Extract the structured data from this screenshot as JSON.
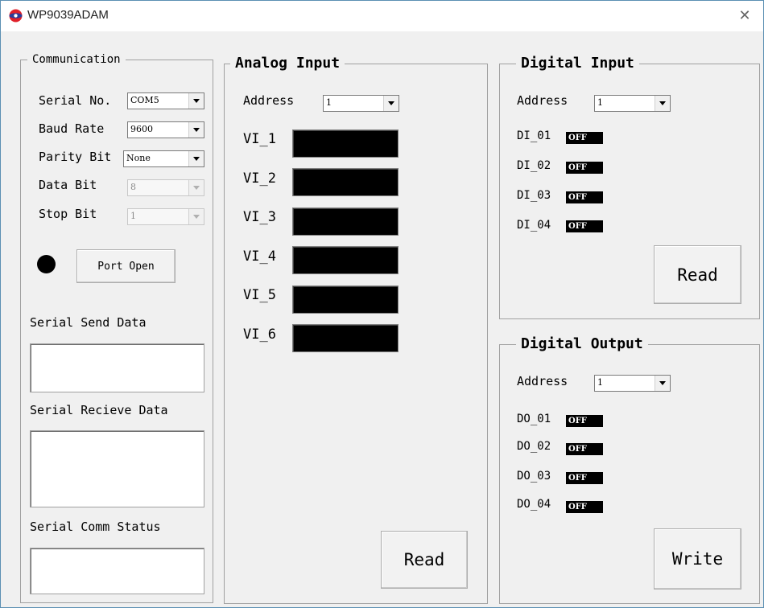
{
  "window": {
    "title": "WP9039ADAM"
  },
  "communication": {
    "legend": "Communication",
    "serial_no": {
      "label": "Serial No.",
      "value": "COM5"
    },
    "baud_rate": {
      "label": "Baud Rate",
      "value": "9600"
    },
    "parity_bit": {
      "label": "Parity Bit",
      "value": "None"
    },
    "data_bit": {
      "label": "Data Bit",
      "value": "8"
    },
    "stop_bit": {
      "label": "Stop Bit",
      "value": "1"
    },
    "port_open_label": "Port Open",
    "send_data_label": "Serial Send Data",
    "send_data_value": "",
    "receive_data_label": "Serial Recieve Data",
    "receive_data_value": "",
    "status_label": "Serial Comm Status",
    "status_value": ""
  },
  "analog_input": {
    "legend": "Analog Input",
    "address_label": "Address",
    "address_value": "1",
    "channels": [
      "VI_1",
      "VI_2",
      "VI_3",
      "VI_4",
      "VI_5",
      "VI_6"
    ],
    "read_label": "Read"
  },
  "digital_input": {
    "legend": "Digital Input",
    "address_label": "Address",
    "address_value": "1",
    "channels": [
      {
        "label": "DI_01",
        "state": "OFF"
      },
      {
        "label": "DI_02",
        "state": "OFF"
      },
      {
        "label": "DI_03",
        "state": "OFF"
      },
      {
        "label": "DI_04",
        "state": "OFF"
      }
    ],
    "read_label": "Read"
  },
  "digital_output": {
    "legend": "Digital Output",
    "address_label": "Address",
    "address_value": "1",
    "channels": [
      {
        "label": "DO_01",
        "state": "OFF"
      },
      {
        "label": "DO_02",
        "state": "OFF"
      },
      {
        "label": "DO_03",
        "state": "OFF"
      },
      {
        "label": "DO_04",
        "state": "OFF"
      }
    ],
    "write_label": "Write"
  },
  "colors": {
    "window_border": "#5b8fb3",
    "background": "#f0f0f0",
    "display": "#000000",
    "icon_red": "#e0202a",
    "icon_blue": "#2a3c9a"
  }
}
